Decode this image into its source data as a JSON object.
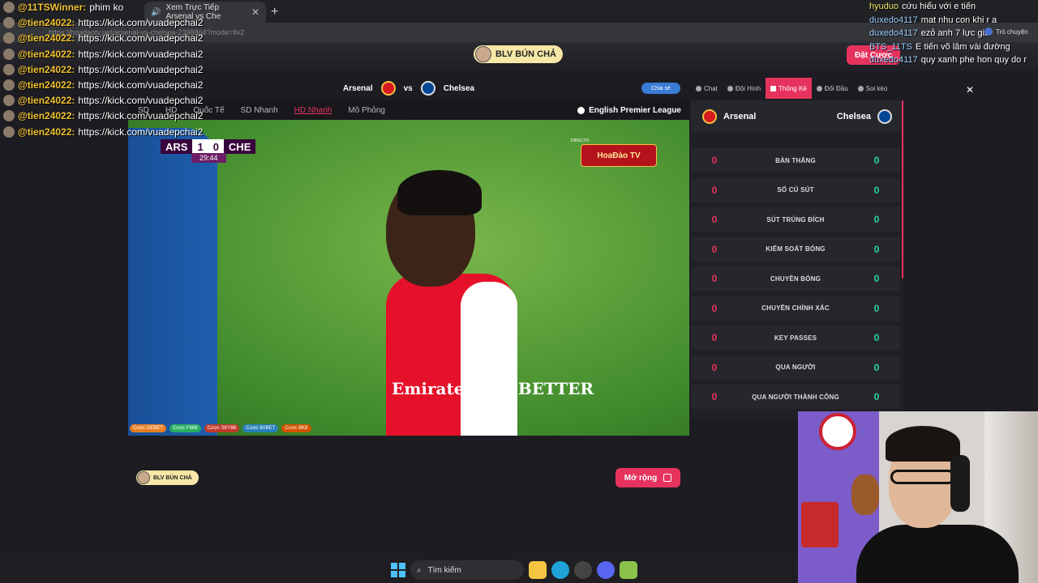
{
  "browser": {
    "tab_title": "Xem Trực Tiếp Arsenal vs Che",
    "tab_close": "✕",
    "new_tab": "+",
    "address": "https://hoadaotv.net/arsenal-vs-chelsea-2398804?mode=flv2"
  },
  "header": {
    "host_name": "BLV BÚN CHẢ",
    "bet_button": "Đặt Cược"
  },
  "match": {
    "home": "Arsenal",
    "vs": "vs",
    "away": "Chelsea",
    "share": "Chia sẻ"
  },
  "quality_tabs": [
    {
      "label": "SD",
      "active": false
    },
    {
      "label": "HD",
      "active": false
    },
    {
      "label": "Quốc Tế",
      "active": false
    },
    {
      "label": "SD Nhanh",
      "active": false
    },
    {
      "label": "HD Nhanh",
      "active": true
    },
    {
      "label": "Mô Phỏng",
      "active": false
    }
  ],
  "league": "English Premier League",
  "scoreboard": {
    "home_code": "ARS",
    "home_score": "1",
    "away_score": "0",
    "away_code": "CHE",
    "time": "29:44",
    "directo": "DIRECTO",
    "tv_logo": "HoaĐào TV"
  },
  "video_text": {
    "sponsor": "Emirates FLY BETTER"
  },
  "bet_links": [
    {
      "label": "Cược DEBET",
      "color": "#e67e22"
    },
    {
      "label": "Cược F888",
      "color": "#27ae60"
    },
    {
      "label": "Cược SKY88",
      "color": "#c0392b"
    },
    {
      "label": "Cược 8XBET",
      "color": "#2980b9"
    },
    {
      "label": "Cược BK8",
      "color": "#d35400"
    }
  ],
  "footer": {
    "host_name": "BLV BÚN CHẢ",
    "expand_button": "Mở rộng"
  },
  "panel": {
    "tabs": [
      {
        "label": "Chat",
        "active": false
      },
      {
        "label": "Đội Hình",
        "active": false
      },
      {
        "label": "Thống Kê",
        "active": true
      },
      {
        "label": "Đối Đầu",
        "active": false
      },
      {
        "label": "Soi kèo",
        "active": false
      }
    ],
    "close": "✕",
    "home_team": "Arsenal",
    "away_team": "Chelsea",
    "stats": [
      {
        "label": "BÀN THẮNG",
        "home": "0",
        "away": "0"
      },
      {
        "label": "SỐ CÚ SÚT",
        "home": "0",
        "away": "0"
      },
      {
        "label": "SÚT TRÚNG ĐÍCH",
        "home": "0",
        "away": "0"
      },
      {
        "label": "KIỂM SOÁT BÓNG",
        "home": "0",
        "away": "0"
      },
      {
        "label": "CHUYỀN BÓNG",
        "home": "0",
        "away": "0"
      },
      {
        "label": "CHUYỀN CHÍNH XÁC",
        "home": "0",
        "away": "0"
      },
      {
        "label": "KEY PASSES",
        "home": "0",
        "away": "0"
      },
      {
        "label": "QUA NGƯỜI",
        "home": "0",
        "away": "0"
      },
      {
        "label": "QUA NGƯỜI THÀNH CÔNG",
        "home": "0",
        "away": "0"
      }
    ]
  },
  "left_chat": [
    {
      "user": "@11TSWinner:",
      "msg": "phim ko"
    },
    {
      "user": "@tien24022:",
      "msg": "https://kick.com/vuadepchai2"
    },
    {
      "user": "@tien24022:",
      "msg": "https://kick.com/vuadepchai2"
    },
    {
      "user": "@tien24022:",
      "msg": "https://kick.com/vuadepchai2"
    },
    {
      "user": "@tien24022:",
      "msg": "https://kick.com/vuadepchai2"
    },
    {
      "user": "@tien24022:",
      "msg": "https://kick.com/vuadepchai2"
    },
    {
      "user": "@tien24022:",
      "msg": "https://kick.com/vuadepchai2"
    },
    {
      "user": "@tien24022:",
      "msg": "https://kick.com/vuadepchai2"
    },
    {
      "user": "@tien24022:",
      "msg": "https://kick.com/vuadepchai2"
    }
  ],
  "right_chat": [
    {
      "user": "hyuduo",
      "msg": "cứu hiểu với e tiến"
    },
    {
      "user": "duxedo4117",
      "msg": "mat nhu con khi r a"
    },
    {
      "user": "duxedo4117",
      "msg": "ezỏ anh 7 lực già"
    },
    {
      "user": "BTS_11TS",
      "msg": "E tiến võ lâm vài đường"
    },
    {
      "user": "duxedo4117",
      "msg": "quy xanh phe hon quy do r"
    }
  ],
  "helper": "Trò chuyện",
  "taskbar": {
    "search": "Tìm kiếm"
  },
  "colors": {
    "accent": "#e6335e",
    "stat_home": "#e6335e",
    "stat_away": "#2bd4a0",
    "arsenal_red": "#d71920",
    "chelsea_blue": "#034694"
  }
}
